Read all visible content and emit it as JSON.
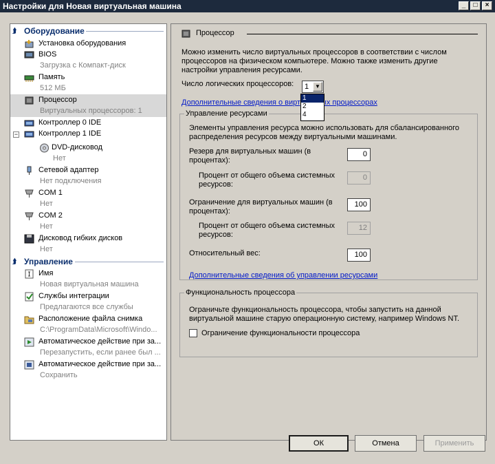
{
  "window": {
    "title": "Настройки для Новая виртуальная машина",
    "controls": [
      "_",
      "□",
      "×"
    ]
  },
  "sidebar": {
    "hardware_header": "Оборудование",
    "management_header": "Управление",
    "items": [
      {
        "label": "Установка оборудования",
        "sub": ""
      },
      {
        "label": "BIOS",
        "sub": "Загрузка с Компакт-диск"
      },
      {
        "label": "Память",
        "sub": "512 МБ"
      },
      {
        "label": "Процессор",
        "sub": "Виртуальных процессоров: 1"
      },
      {
        "label": "Контроллер 0 IDE",
        "sub": ""
      },
      {
        "label": "Контроллер 1 IDE",
        "sub": ""
      },
      {
        "label": "DVD-дисковод",
        "sub": "Нет"
      },
      {
        "label": "Сетевой адаптер",
        "sub": "Нет подключения"
      },
      {
        "label": "COM 1",
        "sub": "Нет"
      },
      {
        "label": "COM 2",
        "sub": "Нет"
      },
      {
        "label": "Дисковод гибких дисков",
        "sub": "Нет"
      }
    ],
    "mgmt_items": [
      {
        "label": "Имя",
        "sub": "Новая виртуальная машина"
      },
      {
        "label": "Службы интеграции",
        "sub": "Предлагаются все службы"
      },
      {
        "label": "Расположение файла снимка",
        "sub": "C:\\ProgramData\\Microsoft\\Windo..."
      },
      {
        "label": "Автоматическое действие при за...",
        "sub": "Перезапустить, если ранее был ..."
      },
      {
        "label": "Автоматическое действие при за...",
        "sub": "Сохранить"
      }
    ]
  },
  "processor": {
    "header": "Процессор",
    "intro": "Можно изменить число виртуальных процессоров в соответствии с числом процессоров на физическом компьютере. Можно также изменить другие настройки управления ресурсами.",
    "count_label": "Число логических процессоров:",
    "count_value": "1",
    "count_options": [
      "1",
      "2",
      "4"
    ],
    "more_info_link": "Дополнительные сведения о виртуальных процессорах"
  },
  "resource_control": {
    "legend": "Управление ресурсами",
    "desc": "Элементы управления ресурса можно использовать для сбалансированного распределения ресурсов между виртуальными машинами.",
    "reserve_label": "Резерв для виртуальных машин (в процентах):",
    "reserve_value": "0",
    "reserve_pct_label": "Процент от общего объема системных ресурсов:",
    "reserve_pct_value": "0",
    "limit_label": "Ограничение для виртуальных машин (в процентах):",
    "limit_value": "100",
    "limit_pct_label": "Процент от общего объема системных ресурсов:",
    "limit_pct_value": "12",
    "weight_label": "Относительный вес:",
    "weight_value": "100",
    "more_info_link": "Дополнительные сведения об управлении ресурсами"
  },
  "compat": {
    "legend": "Функциональность процессора",
    "desc": "Ограничьте функциональность процессора, чтобы запустить на данной виртуальной машине старую операционную систему, например Windows NT.",
    "checkbox_label": "Ограничение функциональности процессора"
  },
  "buttons": {
    "ok": "ОК",
    "cancel": "Отмена",
    "apply": "Применить"
  },
  "colors": {
    "titlebar": "#1d2a3d",
    "link": "#0018c8",
    "selection": "#0a246a",
    "header_text": "#0b2f6e"
  }
}
